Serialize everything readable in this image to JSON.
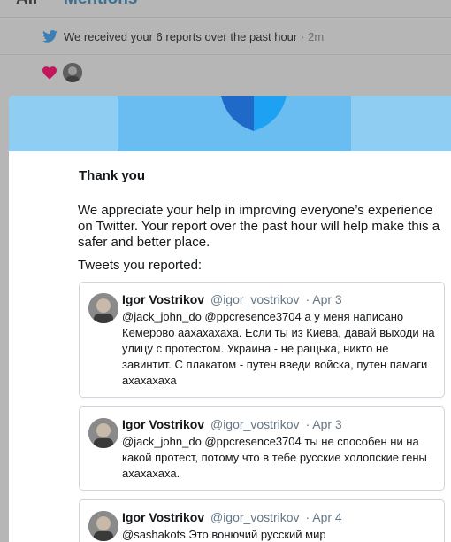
{
  "tabs": {
    "all": "All",
    "mentions": "Mentions"
  },
  "notifications": [
    {
      "text": "We received your 6 reports over the past hour",
      "time": "· 2m",
      "icon": "twitter-bird-icon"
    },
    {
      "icon": "heart-icon"
    }
  ],
  "modal": {
    "title": "Thank you",
    "message": "We appreciate your help in improving everyone’s experience on Twitter. Your report over the past hour will help make this a safer and better place.",
    "reported_label": "Tweets you reported:",
    "tweets": [
      {
        "name": "Igor Vostrikov",
        "handle": "@igor_vostrikov",
        "date": "· Apr 3",
        "text": "@jack_john_do @ppcresence3704 а у меня написано Кемерово аахахахаха. Если ты из Киева, давай выходи на улицу с протестом. Украина - не ращька, никто не завинтит. С плакатом - путен введи войска, путен памаги ахахахаха"
      },
      {
        "name": "Igor Vostrikov",
        "handle": "@igor_vostrikov",
        "date": "· Apr 3",
        "text": "@jack_john_do @ppcresence3704 ты не способен ни на какой протест, потому что в тебе русские холопские гены ахахахаха."
      },
      {
        "name": "Igor Vostrikov",
        "handle": "@igor_vostrikov",
        "date": "· Apr 4",
        "text": "@sashakots Это вонючий русский мир"
      }
    ]
  },
  "colors": {
    "banner": "#90cdf2",
    "shield_dark": "#1f69c9",
    "shield_light": "#1da1f2",
    "heart": "#c2185b"
  }
}
